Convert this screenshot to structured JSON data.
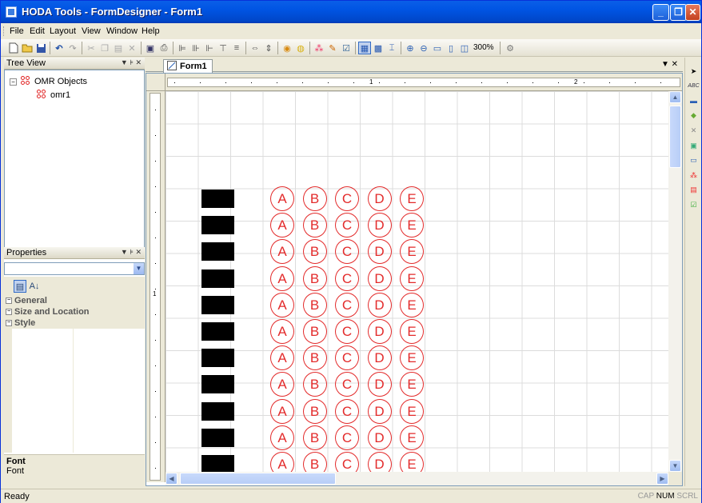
{
  "window": {
    "title": "HODA Tools - FormDesigner - Form1"
  },
  "menu": {
    "items": [
      "File",
      "Edit",
      "Layout",
      "View",
      "Window",
      "Help"
    ]
  },
  "toolbar": {
    "zoom": "300%"
  },
  "tree_view": {
    "title": "Tree View",
    "root": "OMR Objects",
    "child": "omr1"
  },
  "properties": {
    "title": "Properties",
    "combo_value": "",
    "categories": [
      "General",
      "Size and Location",
      "Style"
    ],
    "description_title": "Font",
    "description_text": "Font"
  },
  "document": {
    "tab": "Form1",
    "ruler_h": [
      "1",
      "2"
    ],
    "ruler_v": [
      "1"
    ]
  },
  "omr": {
    "choices": [
      "A",
      "B",
      "C",
      "D",
      "E"
    ],
    "rows": 11
  },
  "status": {
    "text": "Ready",
    "caps": "CAP",
    "num": "NUM",
    "scrl": "SCRL"
  },
  "colors": {
    "titlebar": "#0054e3",
    "bubble": "#e32b2b",
    "marker": "#000000"
  }
}
